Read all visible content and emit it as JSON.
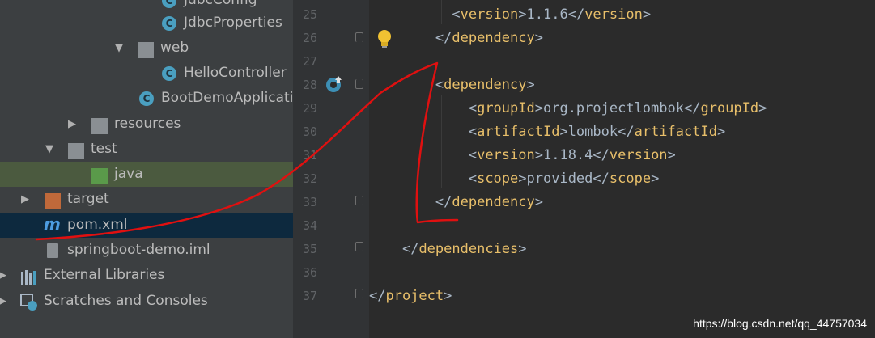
{
  "project_tree": {
    "items": [
      {
        "label": "JdbcConfig",
        "icon": "class-icon"
      },
      {
        "label": "JdbcProperties",
        "icon": "class-icon"
      },
      {
        "label": "web",
        "icon": "package-folder-icon",
        "expanded": true
      },
      {
        "label": "HelloController",
        "icon": "class-icon"
      },
      {
        "label": "BootDemoApplication",
        "icon": "spring-boot-class-icon"
      },
      {
        "label": "resources",
        "icon": "resources-folder-icon",
        "expanded": false
      },
      {
        "label": "test",
        "icon": "folder-icon",
        "expanded": true
      },
      {
        "label": "java",
        "icon": "test-source-folder-icon"
      },
      {
        "label": "target",
        "icon": "excluded-folder-icon",
        "expanded": false
      },
      {
        "label": "pom.xml",
        "icon": "maven-icon",
        "selected": true
      },
      {
        "label": "springboot-demo.iml",
        "icon": "iml-file-icon"
      },
      {
        "label": "External Libraries",
        "icon": "libraries-icon",
        "expanded": false
      },
      {
        "label": "Scratches and Consoles",
        "icon": "scratches-icon",
        "expanded": false
      }
    ]
  },
  "editor": {
    "line_numbers": [
      "25",
      "26",
      "27",
      "28",
      "29",
      "30",
      "31",
      "32",
      "33",
      "34",
      "35",
      "36",
      "37"
    ],
    "lines": {
      "l25": {
        "tag": "version",
        "text": "1.1.6"
      },
      "l26": {
        "close": "dependency"
      },
      "l28": {
        "open": "dependency"
      },
      "l29": {
        "tag": "groupId",
        "text": "org.projectlombok"
      },
      "l30": {
        "tag": "artifactId",
        "text": "lombok"
      },
      "l31": {
        "tag": "version",
        "text": "1.18.4"
      },
      "l32": {
        "tag": "scope",
        "text": "provided"
      },
      "l33": {
        "close": "dependency"
      },
      "l35": {
        "close": "dependencies"
      },
      "l37": {
        "close": "project"
      }
    }
  },
  "watermark": "https://blog.csdn.net/qq_44757034",
  "colors": {
    "tag": "#e8bf6a",
    "text": "#a9b7c6",
    "annotation": "#e01010",
    "selection": "#0d293e"
  }
}
